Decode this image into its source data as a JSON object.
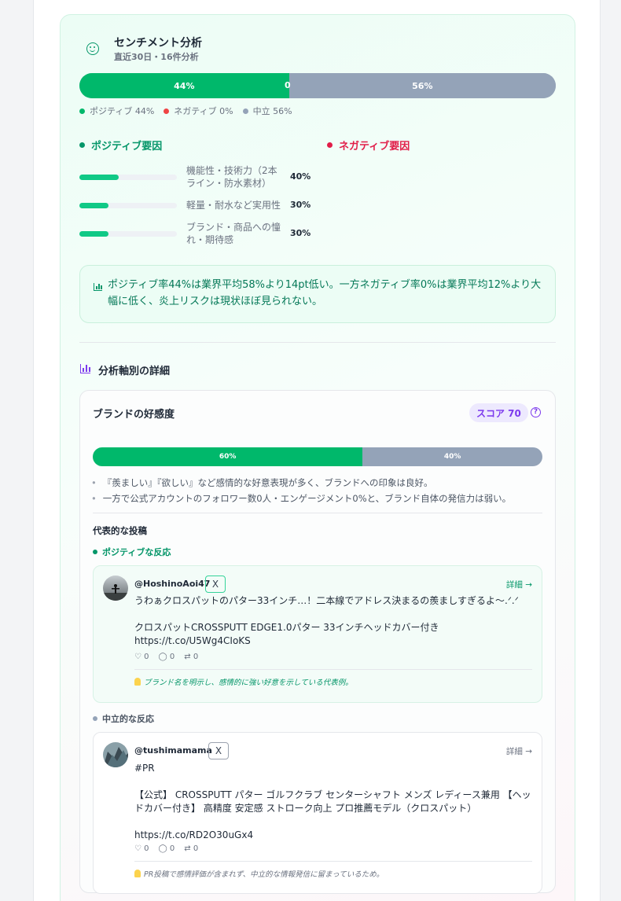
{
  "sentiment": {
    "title": "センチメント分析",
    "subtitle": "直近30日・16件分析",
    "positive_pct": 44,
    "negative_pct": 0,
    "neutral_pct": 56,
    "bar_labels": {
      "positive": "44%",
      "negative": "0",
      "neutral": "56%"
    },
    "legend": [
      {
        "label": "ポジティブ 44%",
        "color": "#00b86b"
      },
      {
        "label": "ネガティブ 0%",
        "color": "#ef4444"
      },
      {
        "label": "中立 56%",
        "color": "#94a3b8"
      }
    ],
    "colors": {
      "positive": "#00b86b",
      "negative": "#e11d48",
      "neutral": "#94a3b8"
    }
  },
  "factors": {
    "positive_title": "ポジティブ要因",
    "negative_title": "ネガティブ要因",
    "positive": [
      {
        "label": "機能性・技術力（2本ライン・防水素材）",
        "pct": "40%",
        "value": 0.4
      },
      {
        "label": "軽量・耐水など実用性",
        "pct": "30%",
        "value": 0.3
      },
      {
        "label": "ブランド・商品への憧れ・期待感",
        "pct": "30%",
        "value": 0.3
      }
    ]
  },
  "insight": "ポジティブ率44%は業界平均58%より14pt低い。一方ネガティブ率0%は業界平均12%より大幅に低く、炎上リスクは現状ほぼ見られない。",
  "axis_section": {
    "title": "分析軸別の詳細",
    "card": {
      "title": "ブランドの好感度",
      "score": "スコア 70",
      "help": "?",
      "bar": {
        "positive_label": "60%",
        "neutral_label": "40%",
        "positive": 0.6
      },
      "bullets": [
        "『羨ましい』『欲しい』など感情的な好意表現が多く、ブランドへの印象は良好。",
        "一方で公式アカウントのフォロワー数0人・エンゲージメント0%と、ブランド自体の発信力は弱い。"
      ],
      "rep_title": "代表的な投稿",
      "positive_label": "ポジティブな反応",
      "neutral_label": "中立的な反応",
      "posts": {
        "positive": {
          "handle": "@HoshinoAoi47",
          "platform": "X",
          "detail": "詳細 →",
          "text": "うわぁクロスパットのパター33インチ…！二本線でアドレス決まるの羨ましすぎるよ〜.ᐟ.ᐟ\n\nクロスパットCROSSPUTT EDGE1.0パター 33インチヘッドカバー付き\nhttps://t.co/U5Wg4CIoKS",
          "likes": "0",
          "comments": "0",
          "reposts": "0",
          "note": "ブランド名を明示し、感情的に強い好意を示している代表例。"
        },
        "neutral": {
          "handle": "@tushimamama",
          "platform": "X",
          "detail": "詳細 →",
          "text": "#PR\n\n【公式】 CROSSPUTT パター ゴルフクラブ センターシャフト メンズ レディース兼用 【ヘッドカバー付き】 高精度 安定感 ストローク向上 プロ推薦モデル（クロスパット）\n\nhttps://t.co/RD2O30uGx4",
          "likes": "0",
          "comments": "0",
          "reposts": "0",
          "note": "PR投稿で感情評価が含まれず、中立的な情報発信に留まっているため。"
        }
      }
    }
  }
}
